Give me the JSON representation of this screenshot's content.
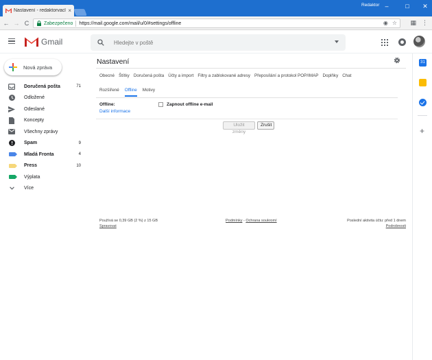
{
  "browser": {
    "tab_title": "Nastavení - redaktorvaclav",
    "tab_close": "×",
    "profile_name": "Redaktor",
    "window_controls": {
      "minimize": "–",
      "maximize": "□",
      "close": "✕"
    },
    "nav": {
      "back": "←",
      "forward": "→",
      "reload": "C"
    },
    "secure_label": "Zabezpečeno",
    "url": "https://mail.google.com/mail/u/0/#settings/offline",
    "omnibox_icons": [
      "eye-icon",
      "star-icon"
    ],
    "toolbar_icons": [
      "extension-icon",
      "menu-icon"
    ],
    "omni_glyphs": {
      "eye": "◉",
      "star": "☆"
    },
    "tb_glyphs": {
      "ext": "▦",
      "menu": "⋮"
    }
  },
  "header": {
    "app_name": "Gmail",
    "search_placeholder": "Hledejte v poště",
    "brand_colors": {
      "red": "#ea4335",
      "blue": "#4285f4",
      "green": "#34a853",
      "yellow": "#fbbc04"
    }
  },
  "sidebar": {
    "compose_label": "Nová zpráva",
    "items": [
      {
        "label": "Doručená pošta",
        "count": "71",
        "bold": true,
        "icon": "inbox-icon"
      },
      {
        "label": "Odložené",
        "count": "",
        "bold": false,
        "icon": "clock-icon"
      },
      {
        "label": "Odeslané",
        "count": "",
        "bold": false,
        "icon": "send-icon"
      },
      {
        "label": "Koncepty",
        "count": "",
        "bold": false,
        "icon": "draft-icon"
      },
      {
        "label": "Všechny zprávy",
        "count": "",
        "bold": false,
        "icon": "mail-icon"
      },
      {
        "label": "Spam",
        "count": "9",
        "bold": true,
        "icon": "spam-icon"
      },
      {
        "label": "Mladá Fronta",
        "count": "4",
        "bold": true,
        "icon": "label-icon",
        "color": "#4a86e8"
      },
      {
        "label": "Press",
        "count": "10",
        "bold": true,
        "icon": "label-icon",
        "color": "#f6d77a"
      },
      {
        "label": "Výplata",
        "count": "",
        "bold": false,
        "icon": "label-icon",
        "color": "#16a766"
      },
      {
        "label": "Více",
        "count": "",
        "bold": false,
        "icon": "chevron-down-icon"
      }
    ]
  },
  "settings": {
    "title": "Nastavení",
    "tabs_row1": [
      "Obecné",
      "Štítky",
      "Doručená pošta",
      "Účty a import",
      "Filtry a zablokované adresy",
      "Přeposílání a protokol POP/IMAP",
      "Doplňky",
      "Chat"
    ],
    "tabs_row2": [
      "Rozšířené",
      "Offline",
      "Motivy"
    ],
    "active_tab": "Offline",
    "offline_label": "Offline:",
    "more_info": "Další informace",
    "checkbox_label": "Zapnout offline e-mail",
    "checkbox_checked": false,
    "save_button": "Uložit změny",
    "cancel_button": "Zrušit"
  },
  "footer": {
    "storage": "Používá se 0,39 GB (2 %) z 15 GB",
    "manage": "Spravovat",
    "terms": "Podmínky",
    "separator": " - ",
    "privacy": "Ochrana soukromí",
    "last_activity": "Poslední aktivita účtu: před 1 dnem",
    "details": "Podrobnosti"
  },
  "side_panel": {
    "calendar_day": "31",
    "add": "+"
  }
}
